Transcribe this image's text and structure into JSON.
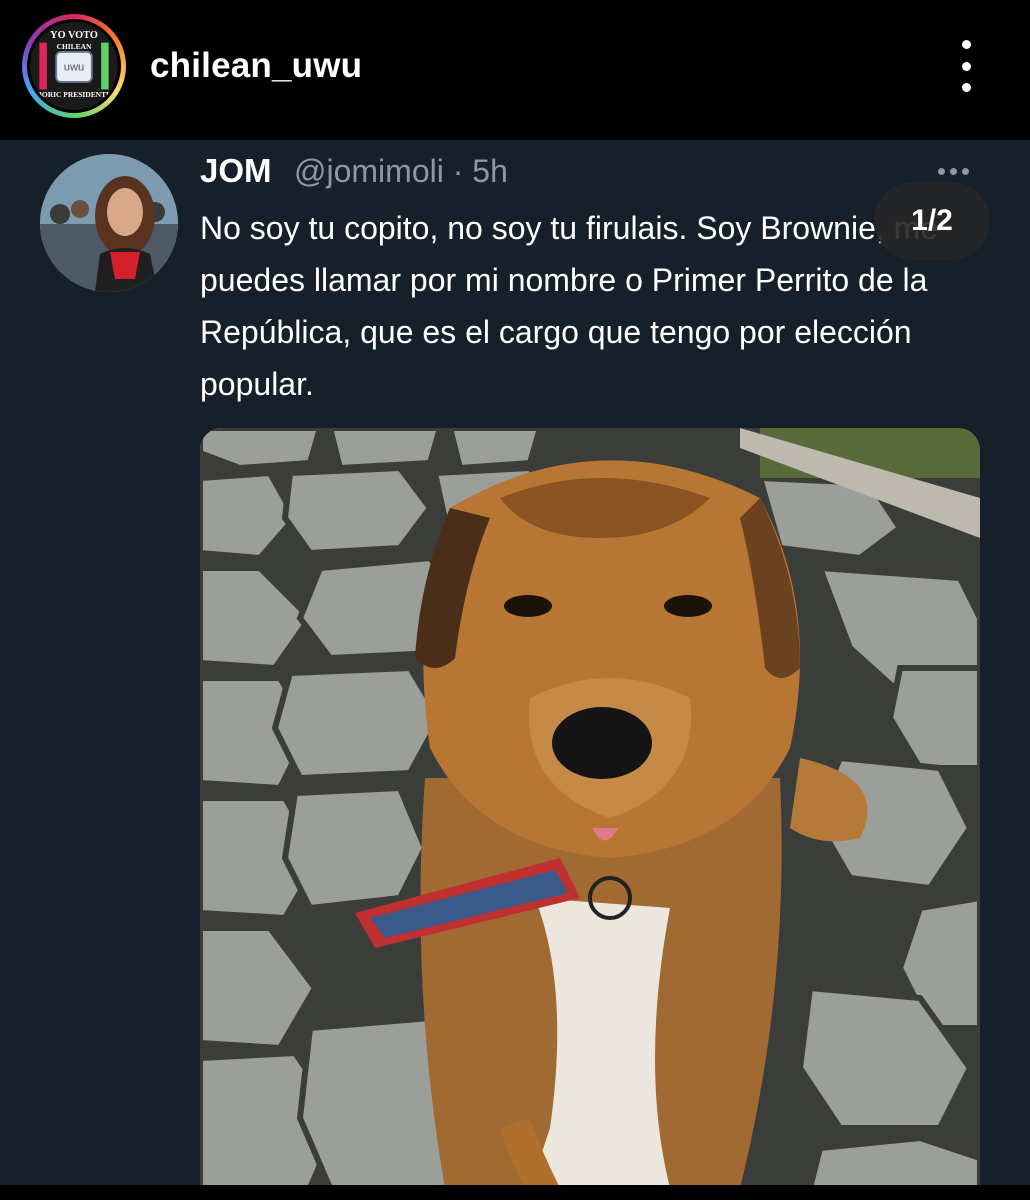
{
  "instagram": {
    "username": "chilean_uwu",
    "avatar_text": {
      "top": "YO VOTO",
      "middle": "CHILEAN",
      "center": "uwu",
      "bottom": "BORIC PRESIDENTE"
    },
    "more_icon": "vertical-ellipsis-icon"
  },
  "tweet": {
    "display_name": "JOM",
    "handle_time": "@jomimoli · 5h",
    "more_icon": "horizontal-ellipsis-icon",
    "text": "No soy tu  copito, no soy tu firulais. Soy Brownie, me puedes llamar por mi nombre o Primer Perrito de la República, que es el cargo que tengo por elección popular.",
    "media_icon": "dog-photo"
  },
  "carousel": {
    "indicator": "1/2"
  },
  "colors": {
    "tweet_background": "#15202b",
    "handle_gray": "#8b98a5",
    "header_background": "#000000"
  }
}
